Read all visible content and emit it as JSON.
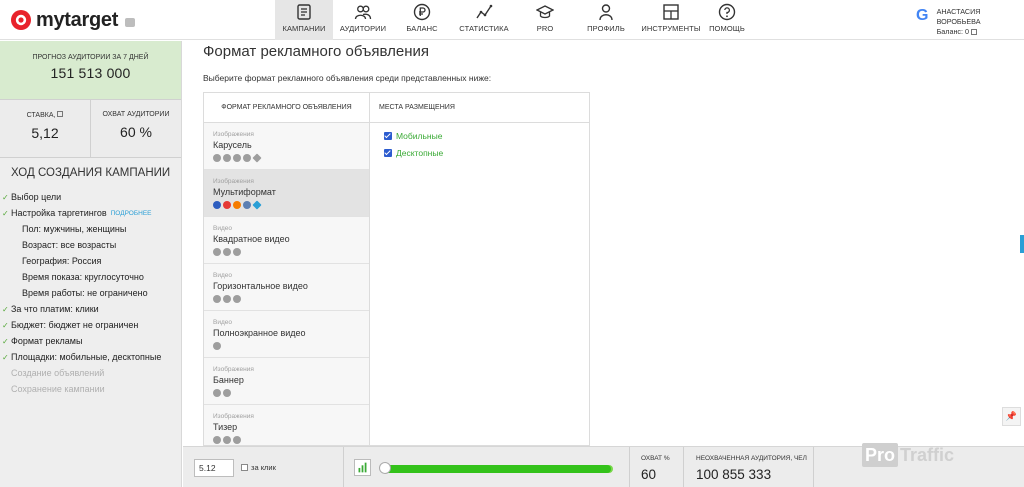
{
  "header": {
    "logo_text": "mytarget",
    "nav": [
      {
        "label": "Кампании",
        "icon": "campaigns-icon",
        "active": true
      },
      {
        "label": "Аудитории",
        "icon": "audiences-icon"
      },
      {
        "label": "Баланс",
        "icon": "ruble-icon"
      },
      {
        "label": "Статистика",
        "icon": "chart-line-icon"
      },
      {
        "label": "Pro",
        "icon": "graduation-cap-icon"
      },
      {
        "label": "Профиль",
        "icon": "profile-icon"
      },
      {
        "label": "Инструменты",
        "icon": "tools-icon"
      },
      {
        "label": "Помощь",
        "icon": "help-icon"
      }
    ],
    "user": {
      "name": "Анастасия Воробьева",
      "balance": "Баланс: 0"
    }
  },
  "sidebar": {
    "forecast_label": "Прогноз аудитории за 7 дней",
    "forecast_value": "151 513 000",
    "bid_label": "Ставка,",
    "bid_value": "5,12",
    "reach_label": "Охват аудитории",
    "reach_value": "60 %",
    "progress_title": "Ход создания кампании",
    "steps": [
      {
        "text": "Выбор цели",
        "done": true
      },
      {
        "text": "Настройка таргетингов",
        "done": true,
        "more": "подробнее"
      },
      {
        "text": "Пол: мужчины, женщины",
        "sub": true
      },
      {
        "text": "Возраст: все возрасты",
        "sub": true
      },
      {
        "text": "География: Россия",
        "sub": true
      },
      {
        "text": "Время показа: круглосуточно",
        "sub": true
      },
      {
        "text": "Время работы: не ограничено",
        "sub": true
      },
      {
        "text": "За что платим: клики",
        "done": true
      },
      {
        "text": "Бюджет: бюджет не ограничен",
        "done": true
      },
      {
        "text": "Формат рекламы",
        "done": true
      },
      {
        "text": "Площадки: мобильные, десктопные",
        "done": true
      },
      {
        "text": "Создание объявлений",
        "disabled": true
      },
      {
        "text": "Сохранение кампании",
        "disabled": true
      }
    ]
  },
  "main": {
    "title": "Формат рекламного объявления",
    "subtitle": "Выберите формат рекламного объявления среди представленных ниже:",
    "formats_header": "Формат рекламного объявления",
    "placements_header": "Места размещения",
    "formats": [
      {
        "category": "Изображения",
        "name": "Карусель",
        "icons": 5
      },
      {
        "category": "Изображения",
        "name": "Мультиформат",
        "icons": 5,
        "selected": true
      },
      {
        "category": "Видео",
        "name": "Квадратное видео",
        "icons": 3
      },
      {
        "category": "Видео",
        "name": "Горизонтальное видео",
        "icons": 3
      },
      {
        "category": "Видео",
        "name": "Полноэкранное видео",
        "icons": 1
      },
      {
        "category": "Изображения",
        "name": "Баннер",
        "icons": 2
      },
      {
        "category": "Изображения",
        "name": "Тизер",
        "icons": 3
      }
    ],
    "placements": [
      {
        "label": "Мобильные",
        "checked": true
      },
      {
        "label": "Десктопные",
        "checked": true
      }
    ]
  },
  "bottom": {
    "bid_value": "5.12",
    "per_click_label": "за клик",
    "reach_label": "Охват %",
    "reach_value": "60",
    "unreached_label": "Неохваченная аудитория, чел",
    "unreached_value": "100 855 333",
    "slider_fraction": 0.99
  },
  "watermark": {
    "pro": "Pro",
    "traffic": "Traffic"
  }
}
